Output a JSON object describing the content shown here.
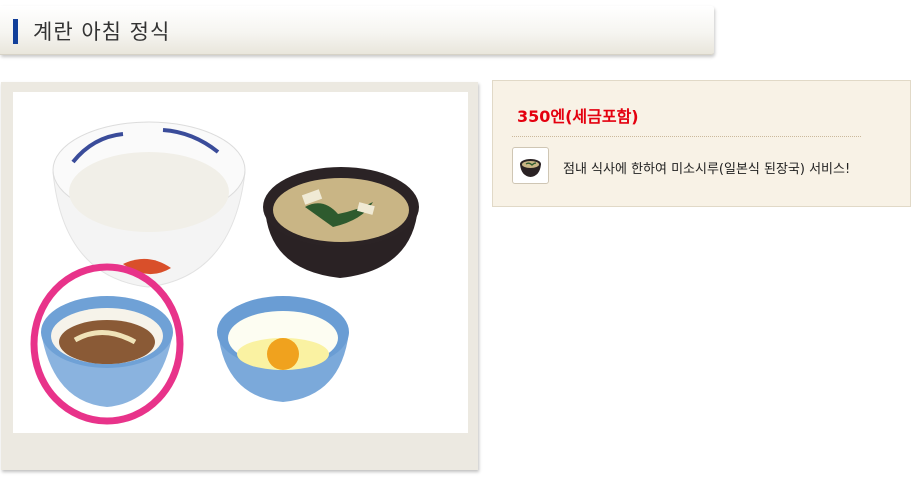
{
  "page": {
    "title": "계란 아침 정식"
  },
  "menu_item": {
    "image_icon": "meal-set-photo",
    "highlight": "circled-side-dish",
    "price": "350엔(세금포함)",
    "note": "점내 식사에 한하여 미소시루(일본식 된장국) 서비스!",
    "note_icon": "miso-soup-icon"
  },
  "colors": {
    "title_accent": "#123f9a",
    "price": "#e4000f",
    "highlight_ring": "#e8338a",
    "panel_background": "#f8f2e6"
  }
}
